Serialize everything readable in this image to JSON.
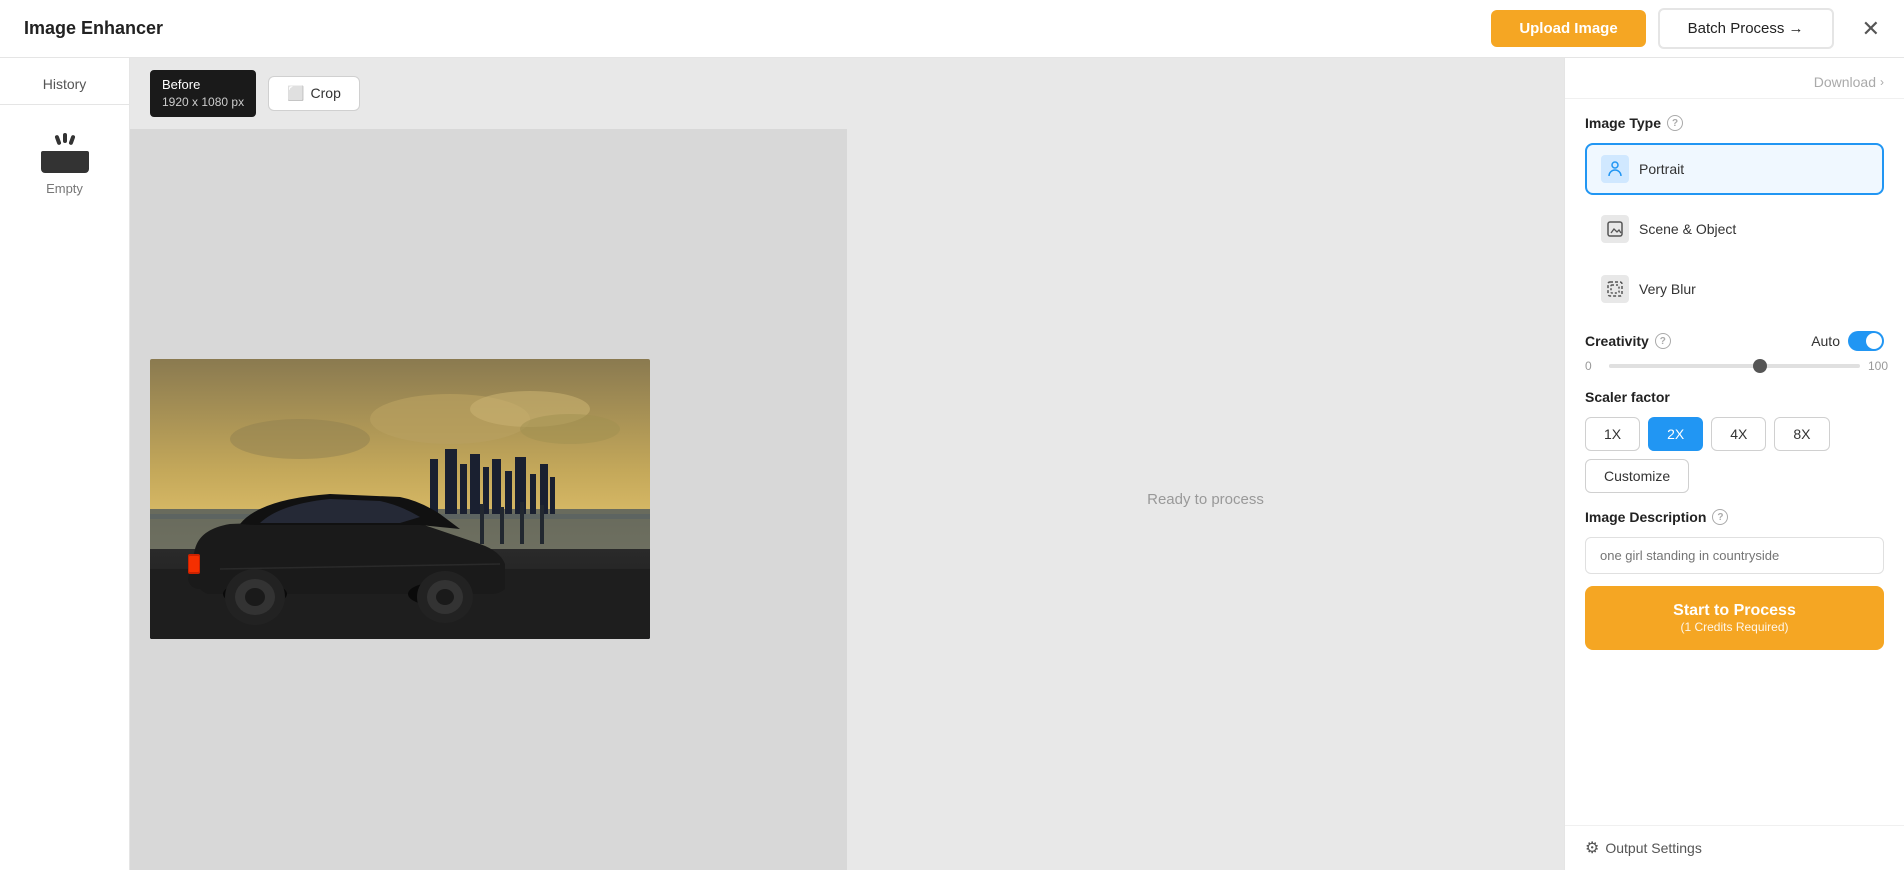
{
  "app": {
    "title": "Image Enhancer"
  },
  "header": {
    "upload_label": "Upload Image",
    "batch_label": "Batch Process →"
  },
  "sidebar": {
    "history_label": "History",
    "empty_label": "Empty"
  },
  "toolbar": {
    "before_label": "Before",
    "dimensions": "1920 x 1080 px",
    "crop_label": "Crop"
  },
  "after_panel": {
    "ready_text": "Ready to process"
  },
  "right_panel": {
    "download_label": "Download",
    "image_type_label": "Image Type",
    "portrait_label": "Portrait",
    "scene_object_label": "Scene & Object",
    "very_blur_label": "Very Blur",
    "creativity_label": "Creativity",
    "auto_label": "Auto",
    "slider_min": "0",
    "slider_max": "100",
    "scaler_label": "Scaler factor",
    "scale_1x": "1X",
    "scale_2x": "2X",
    "scale_4x": "4X",
    "scale_8x": "8X",
    "customize_label": "Customize",
    "desc_label": "Image Description",
    "desc_placeholder": "one girl standing in countryside",
    "start_label": "Start to Process",
    "start_sub": "(1 Credits Required)",
    "output_label": "Output Settings"
  }
}
